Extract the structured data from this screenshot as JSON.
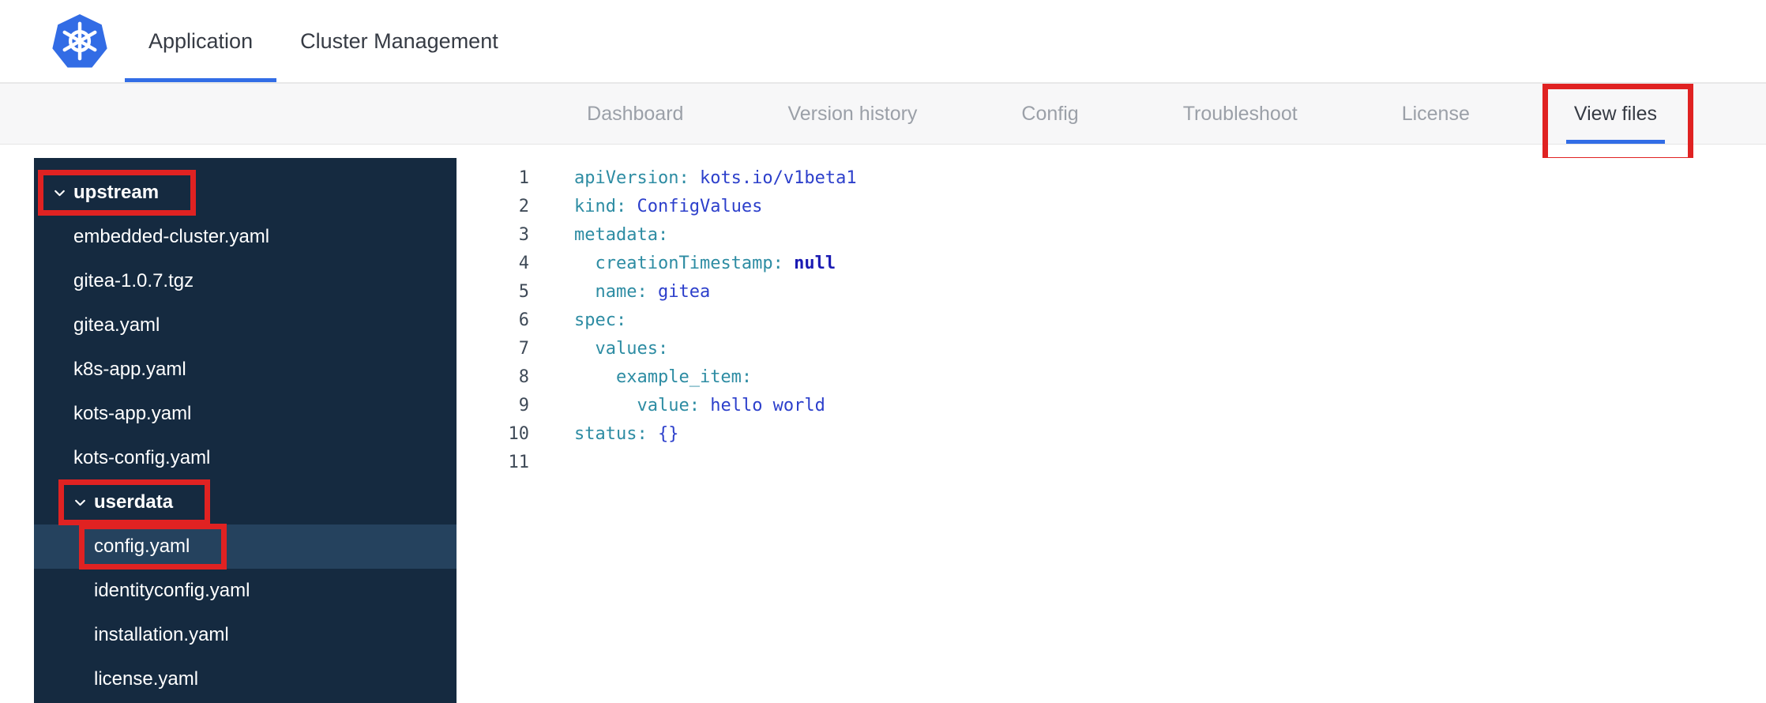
{
  "colors": {
    "annotation": "#e02222",
    "accent_blue": "#326de6",
    "brand_blue": "#326ce5",
    "sidebar_bg": "#152a40",
    "sidebar_selected": "#25425e",
    "code_key": "#2d8ca3",
    "code_value": "#2c3fcb",
    "code_atom": "#1b1bb3"
  },
  "header": {
    "logo": "kubernetes-logo",
    "tabs": [
      {
        "label": "Application",
        "active": true
      },
      {
        "label": "Cluster Management",
        "active": false
      }
    ]
  },
  "subnav": {
    "tabs": [
      {
        "label": "Dashboard",
        "active": false,
        "annotated": false
      },
      {
        "label": "Version history",
        "active": false,
        "annotated": false
      },
      {
        "label": "Config",
        "active": false,
        "annotated": false
      },
      {
        "label": "Troubleshoot",
        "active": false,
        "annotated": false
      },
      {
        "label": "License",
        "active": false,
        "annotated": false
      },
      {
        "label": "View files",
        "active": true,
        "annotated": true
      }
    ]
  },
  "file_tree": {
    "items": [
      {
        "type": "group",
        "label": "upstream",
        "depth": 0,
        "expanded": true,
        "annotated": true,
        "selected": false
      },
      {
        "type": "file",
        "label": "embedded-cluster.yaml",
        "depth": 1,
        "annotated": false,
        "selected": false
      },
      {
        "type": "file",
        "label": "gitea-1.0.7.tgz",
        "depth": 1,
        "annotated": false,
        "selected": false
      },
      {
        "type": "file",
        "label": "gitea.yaml",
        "depth": 1,
        "annotated": false,
        "selected": false
      },
      {
        "type": "file",
        "label": "k8s-app.yaml",
        "depth": 1,
        "annotated": false,
        "selected": false
      },
      {
        "type": "file",
        "label": "kots-app.yaml",
        "depth": 1,
        "annotated": false,
        "selected": false
      },
      {
        "type": "file",
        "label": "kots-config.yaml",
        "depth": 1,
        "annotated": false,
        "selected": false
      },
      {
        "type": "group",
        "label": "userdata",
        "depth": 1,
        "expanded": true,
        "annotated": true,
        "selected": false
      },
      {
        "type": "file",
        "label": "config.yaml",
        "depth": 2,
        "annotated": true,
        "selected": true
      },
      {
        "type": "file",
        "label": "identityconfig.yaml",
        "depth": 2,
        "annotated": false,
        "selected": false
      },
      {
        "type": "file",
        "label": "installation.yaml",
        "depth": 2,
        "annotated": false,
        "selected": false
      },
      {
        "type": "file",
        "label": "license.yaml",
        "depth": 2,
        "annotated": false,
        "selected": false
      }
    ]
  },
  "editor": {
    "language": "yaml",
    "lines": [
      {
        "number": 1,
        "tokens": [
          {
            "type": "key",
            "text": "apiVersion:"
          },
          {
            "type": "value",
            "text": " kots.io/v1beta1"
          }
        ]
      },
      {
        "number": 2,
        "tokens": [
          {
            "type": "key",
            "text": "kind:"
          },
          {
            "type": "value",
            "text": " ConfigValues"
          }
        ]
      },
      {
        "number": 3,
        "tokens": [
          {
            "type": "key",
            "text": "metadata:"
          }
        ]
      },
      {
        "number": 4,
        "tokens": [
          {
            "type": "plain",
            "text": "  "
          },
          {
            "type": "key",
            "text": "creationTimestamp:"
          },
          {
            "type": "atom",
            "text": " null"
          }
        ]
      },
      {
        "number": 5,
        "tokens": [
          {
            "type": "plain",
            "text": "  "
          },
          {
            "type": "key",
            "text": "name:"
          },
          {
            "type": "value",
            "text": " gitea"
          }
        ]
      },
      {
        "number": 6,
        "tokens": [
          {
            "type": "key",
            "text": "spec:"
          }
        ]
      },
      {
        "number": 7,
        "tokens": [
          {
            "type": "plain",
            "text": "  "
          },
          {
            "type": "key",
            "text": "values:"
          }
        ]
      },
      {
        "number": 8,
        "tokens": [
          {
            "type": "plain",
            "text": "    "
          },
          {
            "type": "key",
            "text": "example_item:"
          }
        ]
      },
      {
        "number": 9,
        "tokens": [
          {
            "type": "plain",
            "text": "      "
          },
          {
            "type": "key",
            "text": "value:"
          },
          {
            "type": "value",
            "text": " hello world"
          }
        ]
      },
      {
        "number": 10,
        "tokens": [
          {
            "type": "key",
            "text": "status:"
          },
          {
            "type": "value",
            "text": " {}"
          }
        ]
      },
      {
        "number": 11,
        "tokens": []
      }
    ]
  }
}
